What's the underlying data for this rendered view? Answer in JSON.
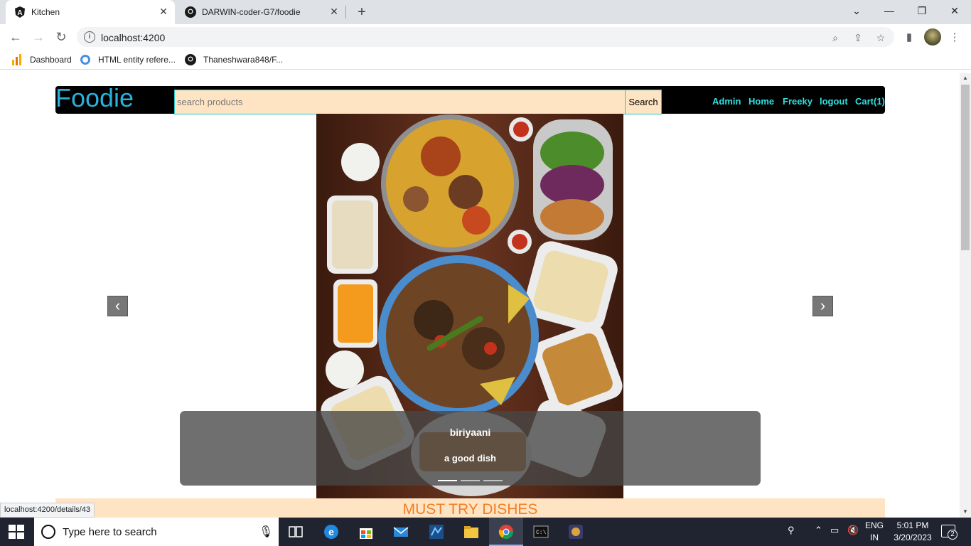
{
  "browser": {
    "tabs": [
      {
        "title": "Kitchen",
        "active": true
      },
      {
        "title": "DARWIN-coder-G7/foodie",
        "active": false
      }
    ],
    "url": "localhost:4200",
    "bookmarks": [
      "Dashboard",
      "HTML entity refere...",
      "Thaneshwara848/F..."
    ],
    "status_url": "localhost:4200/details/43"
  },
  "page": {
    "brand": "Foodie",
    "search": {
      "placeholder": "search products",
      "button": "Search"
    },
    "nav": [
      "Admin",
      "Home",
      "Freeky",
      "logout",
      "Cart(1)"
    ],
    "carousel": {
      "title": "biriyaani",
      "description": "a good dish",
      "slide_count": 3,
      "active_index": 0
    },
    "section_title": "MUST TRY DISHES"
  },
  "taskbar": {
    "search_placeholder": "Type here to search",
    "lang_line1": "ENG",
    "lang_line2": "IN",
    "time": "5:01 PM",
    "date": "3/20/2023",
    "notifications": "2"
  }
}
